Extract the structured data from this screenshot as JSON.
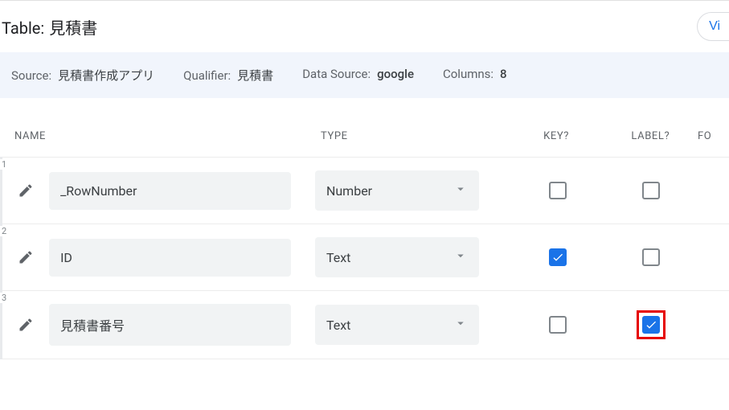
{
  "title": {
    "label": "Table:",
    "value": "見積書"
  },
  "view_button": "Vi",
  "info": {
    "source": {
      "label": "Source:",
      "value": "見積書作成アプリ"
    },
    "qualifier": {
      "label": "Qualifier:",
      "value": "見積書"
    },
    "datasource": {
      "label": "Data Source:",
      "value": "google"
    },
    "columns": {
      "label": "Columns:",
      "value": "8"
    }
  },
  "headers": {
    "name": "NAME",
    "type": "TYPE",
    "key": "KEY?",
    "label": "LABEL?",
    "formula": "FO"
  },
  "rows": [
    {
      "idx": "1",
      "name": "_RowNumber",
      "type": "Number",
      "key": false,
      "label": false,
      "highlight": false
    },
    {
      "idx": "2",
      "name": "ID",
      "type": "Text",
      "key": true,
      "label": false,
      "highlight": false
    },
    {
      "idx": "3",
      "name": "見積書番号",
      "type": "Text",
      "key": false,
      "label": true,
      "highlight": true
    }
  ]
}
